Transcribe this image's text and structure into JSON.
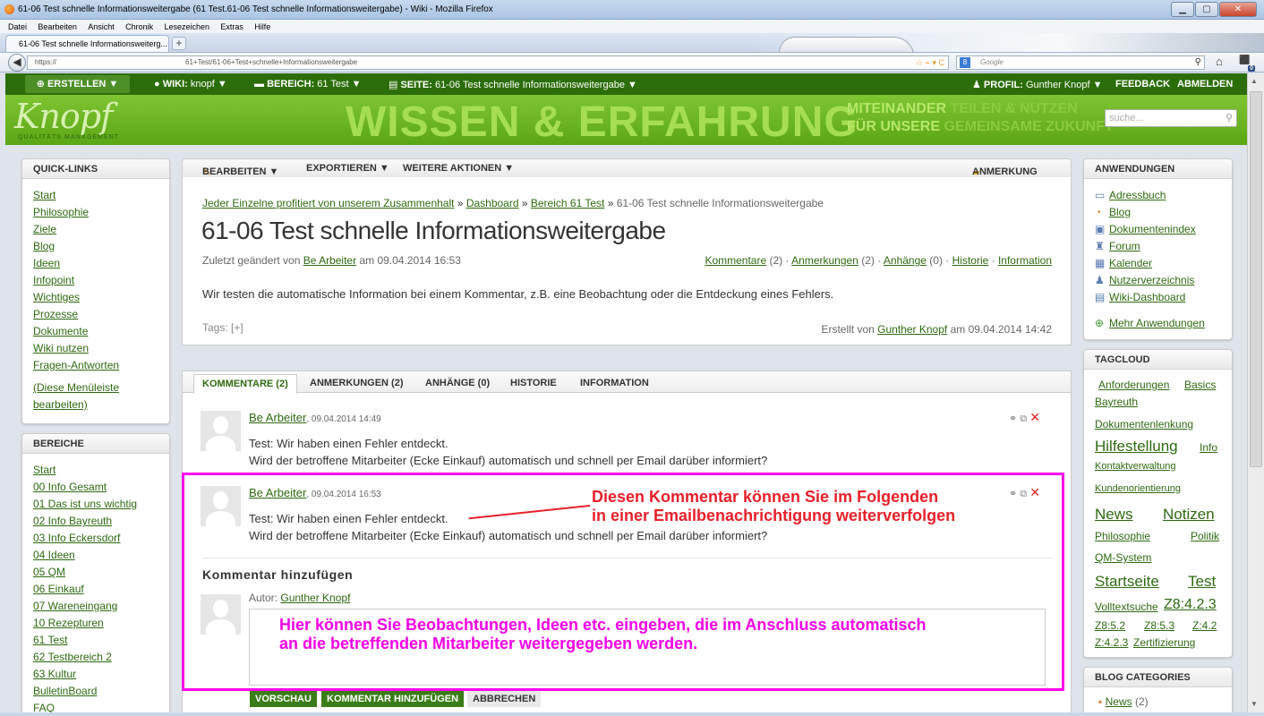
{
  "window": {
    "title": "61-06 Test schnelle Informationsweitergabe (61 Test.61-06 Test schnelle Informationsweitergabe) - Wiki - Mozilla Firefox",
    "menu": [
      "Datei",
      "Bearbeiten",
      "Ansicht",
      "Chronik",
      "Lesezeichen",
      "Extras",
      "Hilfe"
    ],
    "tab_label": "61-06 Test schnelle Informationsweiterg...",
    "new_tab": "+",
    "url_proto": "https://",
    "url_path": "61+Test/61-06+Test+schnelle+Informationsweitergabe",
    "search_placeholder": "Google"
  },
  "wikibar": {
    "create": "ERSTELLEN ▼",
    "wiki_label": "WIKI:",
    "wiki_value": "knopf ▼",
    "area_label": "BEREICH:",
    "area_value": "61 Test ▼",
    "page_label": "SEITE:",
    "page_value": "61-06 Test schnelle Informationsweitergabe ▼",
    "profile_label": "PROFIL:",
    "profile_value": "Gunther Knopf ▼",
    "feedback": "FEEDBACK",
    "logout": "ABMELDEN"
  },
  "banner": {
    "logo": "Knopf",
    "logo_sub": "QUALITÄTS MANAGEMENT",
    "headline": "WISSEN & ERFAHRUNG",
    "slogan_1a": "MITEINANDER ",
    "slogan_1b": "TEILEN & NUTZEN",
    "slogan_2a": "FÜR UNSERE ",
    "slogan_2b": "GEMEINSAME ZUKUNFT",
    "search_placeholder": "suche..."
  },
  "quicklinks": {
    "title": "QUICK-LINKS",
    "items": [
      "Start",
      "Philosophie",
      "Ziele",
      "Blog",
      "Ideen",
      "Infopoint",
      "Wichtiges",
      "Prozesse",
      "Dokumente",
      "Wiki nutzen",
      "Fragen-Antworten"
    ],
    "edit_link_1": "(Diese Menüleiste",
    "edit_link_2": "bearbeiten)"
  },
  "bereiche": {
    "title": "BEREICHE",
    "items": [
      "Start",
      "00 Info Gesamt",
      "01 Das ist uns wichtig",
      "02 Info Bayreuth",
      "03 Info Eckersdorf",
      "04 Ideen",
      "05 QM",
      "06 Einkauf",
      "07 Wareneingang",
      "10 Rezepturen",
      "61 Test",
      "62 Testbereich 2",
      "63 Kultur",
      "BulletinBoard",
      "FAQ"
    ]
  },
  "toolbar": {
    "edit": "BEARBEITEN ▼",
    "export": "EXPORTIEREN ▼",
    "more": "WEITERE AKTIONEN ▼",
    "annotation": "ANMERKUNG"
  },
  "page": {
    "breadcrumb_1": "Jeder Einzelne profitiert von unserem Zusammenhalt",
    "breadcrumb_2": "Dashboard",
    "breadcrumb_3": "Bereich 61 Test",
    "breadcrumb_4": "61-06 Test schnelle Informationsweitergabe",
    "sep": " » ",
    "title": "61-06 Test schnelle Informationsweitergabe",
    "changed_prefix": "Zuletzt geändert von ",
    "changed_by": "Be Arbeiter",
    "changed_at": " am 09.04.2014 16:53",
    "meta_comments": "Kommentare",
    "meta_comments_n": " (2) · ",
    "meta_annotations": "Anmerkungen",
    "meta_annotations_n": " (2) · ",
    "meta_attachments": "Anhänge",
    "meta_attachments_n": " (0) · ",
    "meta_history": "Historie",
    "meta_sep": " · ",
    "meta_info": "Information",
    "body": "Wir testen die automatische Information bei einem Kommentar, z.B. eine Beobachtung oder die Entdeckung eines Fehlers.",
    "tags": "Tags: [+]",
    "created_prefix": "Erstellt von ",
    "created_by": "Gunther Knopf",
    "created_at": " am 09.04.2014 14:42"
  },
  "comment_tabs": [
    "KOMMENTARE (2)",
    "ANMERKUNGEN (2)",
    "ANHÄNGE (0)",
    "HISTORIE",
    "INFORMATION"
  ],
  "comments": [
    {
      "author": "Be Arbeiter",
      "date": ", 09.04.2014 14:49",
      "line1": "Test: Wir haben einen Fehler entdeckt.",
      "line2": "Wird der betroffene Mitarbeiter (Ecke Einkauf) automatisch und schnell per Email darüber informiert?"
    },
    {
      "author": "Be Arbeiter",
      "date": ", 09.04.2014 16:53",
      "line1": "Test: Wir haben einen Fehler entdeckt.",
      "line2": "Wird der betroffene Mitarbeiter (Ecke Einkauf) automatisch und schnell per Email darüber informiert?"
    }
  ],
  "annotations": {
    "red_1": "Diesen Kommentar können Sie im Folgenden",
    "red_2": "in einer Emailbenachrichtigung weiterverfolgen",
    "magenta_1": "Hier können Sie Beobachtungen, Ideen etc. eingeben, die im Anschluss automatisch",
    "magenta_2": "an die betreffenden Mitarbeiter weitergegeben werden."
  },
  "add_comment": {
    "title": "Kommentar hinzufügen",
    "author_label": "Autor: ",
    "author": "Gunther Knopf",
    "preview": "VORSCHAU",
    "submit": "KOMMENTAR HINZUFÜGEN",
    "cancel": "ABBRECHEN"
  },
  "apps": {
    "title": "ANWENDUNGEN",
    "items": [
      "Adressbuch",
      "Blog",
      "Dokumentenindex",
      "Forum",
      "Kalender",
      "Nutzerverzeichnis",
      "Wiki-Dashboard"
    ],
    "more": "Mehr Anwendungen"
  },
  "tagcloud": {
    "title": "TAGCLOUD",
    "r1": [
      "Anforderungen",
      "Basics"
    ],
    "r2": [
      "Bayreuth"
    ],
    "r3": [
      "Dokumentenlenkung"
    ],
    "r4a": "Hilfestellung",
    "r4b": "Info",
    "r5": "Kontaktverwaltung",
    "r6": "Kundenorientierung",
    "r7a": "News",
    "r7b": "Notizen",
    "r8a": "Philosophie",
    "r8b": "Politik",
    "r9": "QM-System",
    "r10a": "Startseite",
    "r10b": "Test",
    "r11a": "Volltextsuche",
    "r11b": "Z8:4.2.3",
    "r12": [
      "Z8:5.2",
      "Z8:5.3",
      "Z:4.2"
    ],
    "r13": [
      "Z:4.2.3",
      "Zertifizierung"
    ]
  },
  "blogcat": {
    "title": "BLOG CATEGORIES",
    "item": "News",
    "count": " (2)"
  },
  "colors": {
    "accent": "#2b6d08",
    "highlight": "#ff00ee",
    "annotation_red": "#e8202a"
  }
}
